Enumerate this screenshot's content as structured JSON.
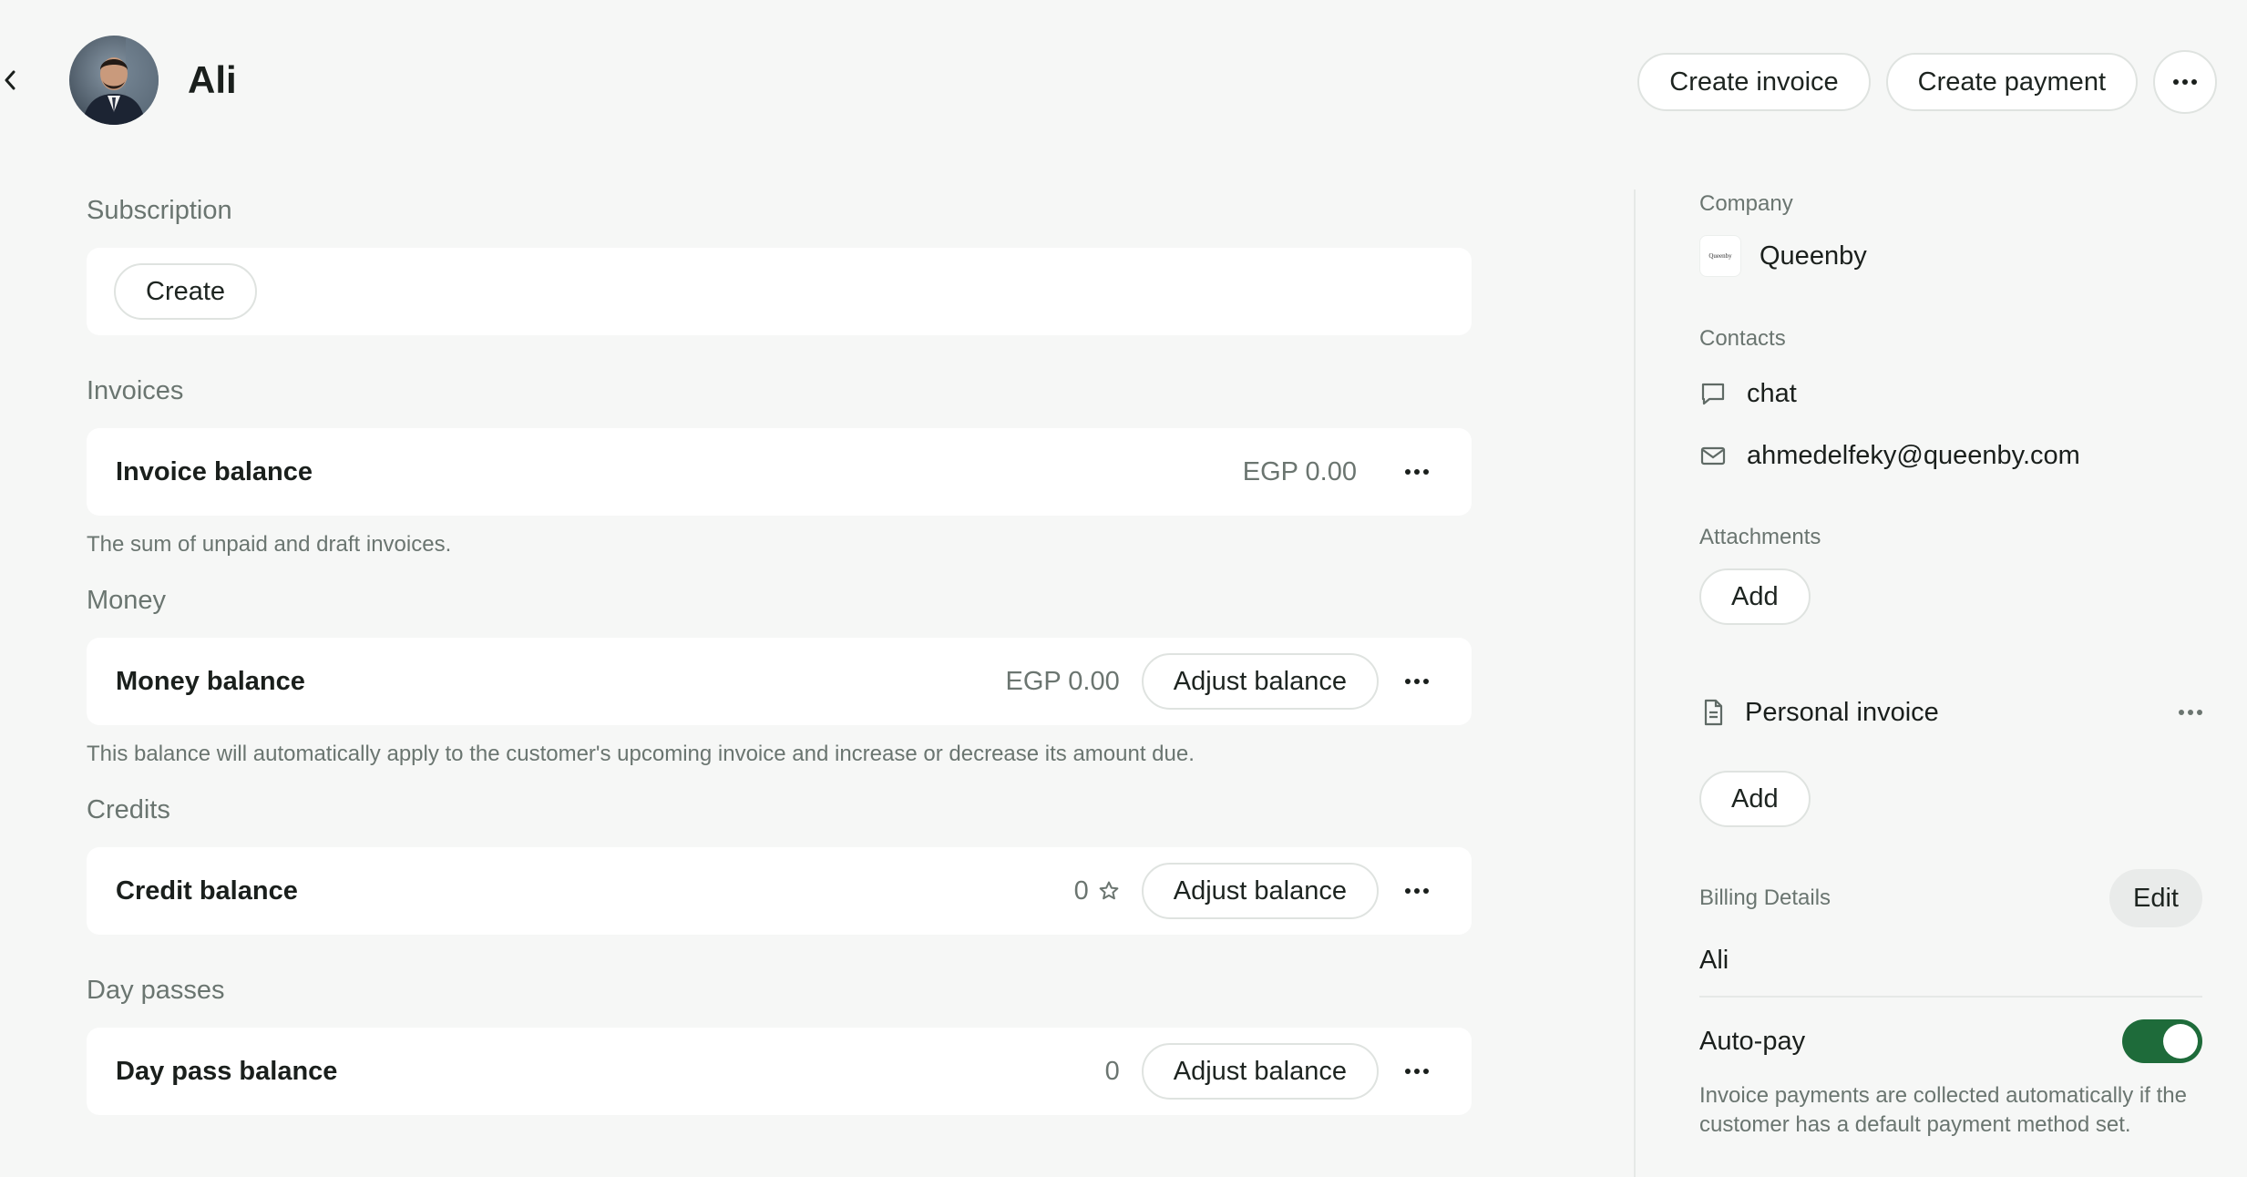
{
  "header": {
    "user_name": "Ali",
    "create_invoice_label": "Create invoice",
    "create_payment_label": "Create payment"
  },
  "subscription": {
    "title": "Subscription",
    "create_label": "Create"
  },
  "invoices": {
    "title": "Invoices",
    "balance_label": "Invoice balance",
    "balance_value": "EGP 0.00",
    "help": "The sum of unpaid and draft invoices."
  },
  "money": {
    "title": "Money",
    "balance_label": "Money balance",
    "balance_value": "EGP 0.00",
    "adjust_label": "Adjust balance",
    "help": "This balance will automatically apply to the customer's upcoming invoice and increase or decrease its amount due."
  },
  "credits": {
    "title": "Credits",
    "balance_label": "Credit balance",
    "balance_value": "0",
    "adjust_label": "Adjust balance"
  },
  "day_passes": {
    "title": "Day passes",
    "balance_label": "Day pass balance",
    "balance_value": "0",
    "adjust_label": "Adjust balance"
  },
  "sidebar": {
    "company_label": "Company",
    "company_name": "Queenby",
    "company_logo_text": "Queenby",
    "contacts_label": "Contacts",
    "contacts": [
      {
        "icon": "chat-icon",
        "text": "chat"
      },
      {
        "icon": "mail-icon",
        "text": "ahmedelfeky@queenby.com"
      }
    ],
    "attachments_label": "Attachments",
    "attachments_add_label": "Add",
    "document_name": "Personal invoice",
    "document_add_label": "Add",
    "billing_label": "Billing Details",
    "billing_edit_label": "Edit",
    "billing_name": "Ali",
    "autopay_label": "Auto-pay",
    "autopay_enabled": true,
    "autopay_help": "Invoice payments are collected automatically if the customer has a default payment method set."
  },
  "colors": {
    "background": "#f6f7f6",
    "card": "#ffffff",
    "muted_text": "#6a7570",
    "toggle_on": "#1e6b3a"
  }
}
